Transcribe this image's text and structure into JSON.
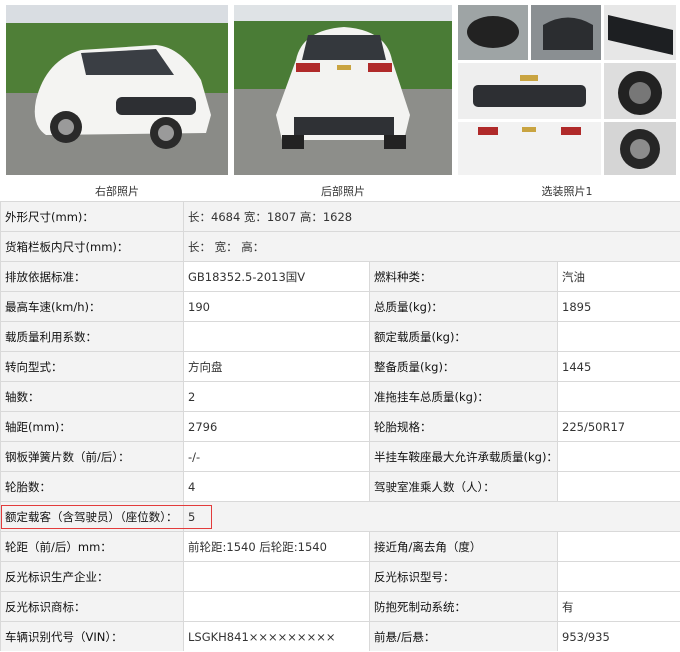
{
  "photos": {
    "captions": [
      "右部照片",
      "后部照片",
      "选装照片1"
    ]
  },
  "colors": {
    "label_bg": "#f3f3f3",
    "border": "#d9d9d9",
    "highlight": "#e23b3b"
  },
  "rows": [
    {
      "full": true,
      "label": "外形尺寸(mm)：",
      "value": "长：4684 宽：1807 高：1628"
    },
    {
      "full": true,
      "label": "货箱栏板内尺寸(mm)：",
      "value": "长： 宽： 高："
    },
    {
      "l1": "排放依据标准：",
      "v1": "GB18352.5-2013国Ⅴ",
      "l2": "燃料种类：",
      "v2": "汽油"
    },
    {
      "l1": "最高车速(km/h)：",
      "v1": "190",
      "l2": "总质量(kg)：",
      "v2": "1895"
    },
    {
      "l1": "载质量利用系数：",
      "v1": "",
      "l2": "额定载质量(kg)：",
      "v2": ""
    },
    {
      "l1": "转向型式：",
      "v1": "方向盘",
      "l2": "整备质量(kg)：",
      "v2": "1445"
    },
    {
      "l1": "轴数：",
      "v1": "2",
      "l2": "准拖挂车总质量(kg)：",
      "v2": ""
    },
    {
      "l1": "轴距(mm)：",
      "v1": "2796",
      "l2": "轮胎规格：",
      "v2": "225/50R17"
    },
    {
      "l1": "钢板弹簧片数（前/后）：",
      "v1": "-/-",
      "l2": "半挂车鞍座最大允许承载质量(kg)：",
      "v2": ""
    },
    {
      "l1": "轮胎数：",
      "v1": "4",
      "l2": "驾驶室准乘人数（人）：",
      "v2": ""
    },
    {
      "full": true,
      "label": "额定载客（含驾驶员）（座位数）：",
      "value": "5"
    },
    {
      "l1": "轮距（前/后）mm：",
      "v1": "前轮距:1540 后轮距:1540",
      "l2": "接近角/离去角（度）",
      "v2": ""
    },
    {
      "l1": "反光标识生产企业：",
      "v1": "",
      "l2": "反光标识型号：",
      "v2": ""
    },
    {
      "l1": "反光标识商标：",
      "v1": "",
      "l2": "防抱死制动系统：",
      "v2": "有"
    },
    {
      "l1": "车辆识别代号（VIN）：",
      "v1": "LSGKH841×××××××××",
      "l2": "前悬/后悬：",
      "v2": "953/935"
    }
  ]
}
